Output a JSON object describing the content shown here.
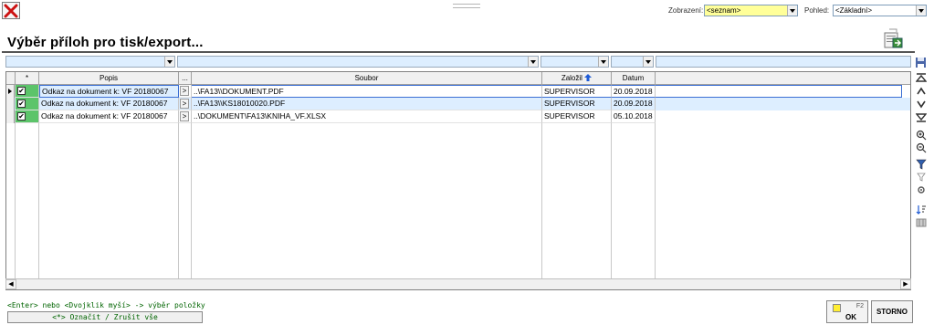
{
  "toolbar": {
    "zobrazeni_label": "Zobrazení:",
    "zobrazeni_value": "<seznam>",
    "pohled_label": "Pohled:",
    "pohled_value": "<Základní>"
  },
  "title": "Výběr příloh pro tisk/export...",
  "columns": {
    "mark": "*",
    "popis": "Popis",
    "more": "...",
    "soubor": "Soubor",
    "zalozil": "Založil",
    "datum": "Datum"
  },
  "rows": [
    {
      "checked": "✔",
      "popis": "Odkaz na dokument k: VF 20180067",
      "btn": ">",
      "soubor": "..\\FA13\\\\DOKUMENT.PDF",
      "zalozil": "SUPERVISOR",
      "datum": "20.09.2018"
    },
    {
      "checked": "✔",
      "popis": "Odkaz na dokument k: VF 20180067",
      "btn": ">",
      "soubor": "..\\FA13\\\\KS18010020.PDF",
      "zalozil": "SUPERVISOR",
      "datum": "20.09.2018"
    },
    {
      "checked": "✔",
      "popis": "Odkaz na dokument k: VF 20180067",
      "btn": ">",
      "soubor": "..\\DOKUMENT\\FA13\\KNIHA_VF.XLSX",
      "zalozil": "SUPERVISOR",
      "datum": "05.10.2018"
    }
  ],
  "footer": {
    "hint": "<Enter> nebo <Dvojklik myší> -> výběr položky",
    "mark_all": "<*> Označit / Zrušit vše",
    "ok_key": "F2",
    "ok_label": "OK",
    "storno_label": "STORNO"
  },
  "colors": {
    "accent_yellow": "#ffff99",
    "checkbox_green": "#5cc46a",
    "selected_row": "#ddeeff",
    "hint_green": "#006400"
  },
  "icons": {
    "close": "close-x-icon",
    "export": "export-icon",
    "save": "save-icon",
    "sort_asc": "sort-arrow-icon"
  }
}
